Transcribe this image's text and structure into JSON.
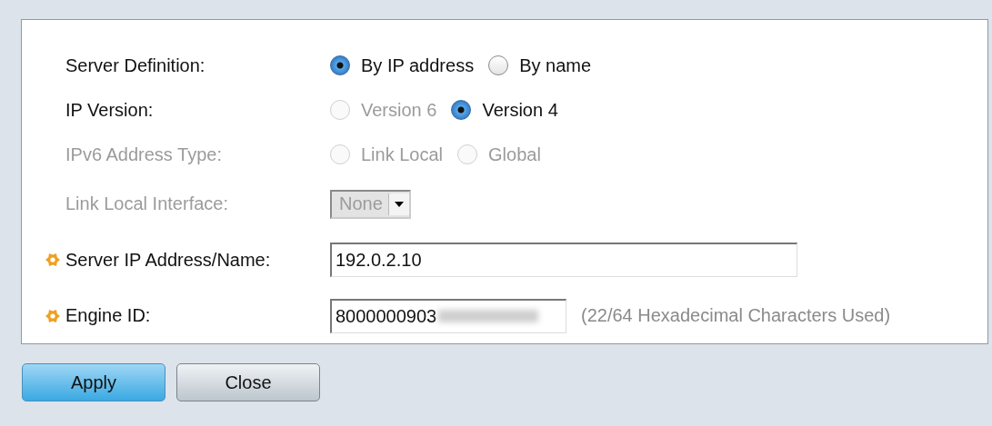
{
  "form": {
    "rows": [
      {
        "kind": "radio",
        "label": "Server Definition:",
        "disabled": false,
        "required": false,
        "options": [
          {
            "label": "By IP address",
            "selected": true,
            "disabled": false
          },
          {
            "label": "By name",
            "selected": false,
            "disabled": false
          }
        ]
      },
      {
        "kind": "radio",
        "label": "IP Version:",
        "disabled": false,
        "required": false,
        "options": [
          {
            "label": "Version 6",
            "selected": false,
            "disabled": true
          },
          {
            "label": "Version 4",
            "selected": true,
            "disabled": false
          }
        ]
      },
      {
        "kind": "radio",
        "label": "IPv6 Address Type:",
        "disabled": true,
        "required": false,
        "options": [
          {
            "label": "Link Local",
            "selected": false,
            "disabled": true
          },
          {
            "label": "Global",
            "selected": false,
            "disabled": true
          }
        ]
      },
      {
        "kind": "select",
        "label": "Link Local Interface:",
        "disabled": true,
        "required": false,
        "value": "None"
      },
      {
        "kind": "text",
        "label": "Server IP Address/Name:",
        "disabled": false,
        "required": true,
        "value": "192.0.2.10",
        "wide": true
      },
      {
        "kind": "text",
        "label": "Engine ID:",
        "disabled": false,
        "required": true,
        "value": "8000000903",
        "redacted": true,
        "wide": false,
        "note": "(22/64 Hexadecimal Characters Used)"
      }
    ]
  },
  "buttons": [
    {
      "label": "Apply",
      "primary": true
    },
    {
      "label": "Close",
      "primary": false
    }
  ]
}
